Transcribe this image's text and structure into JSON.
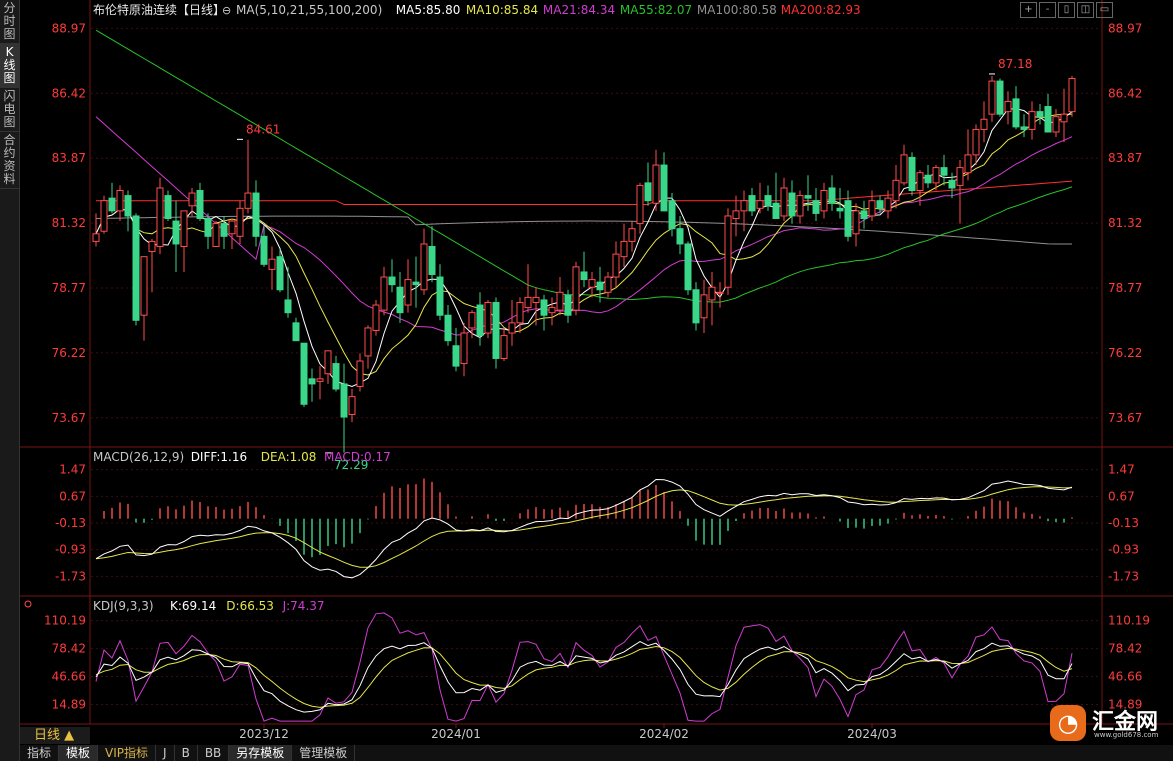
{
  "sidebar": {
    "tabs": [
      "分时图",
      "K线图",
      "闪电图",
      "合约资料"
    ],
    "active_index": 1
  },
  "toolbar": {
    "buttons": [
      "+",
      "-",
      "▯",
      "◫",
      "▭"
    ]
  },
  "footer": {
    "period_label": "日线 ▲",
    "tabs": [
      "指标",
      "模板",
      "VIP指标",
      "J",
      "B",
      "BB",
      "另存模板",
      "管理模板"
    ],
    "active_tabs": [
      1,
      6
    ]
  },
  "logo": {
    "text": "汇金网",
    "url": "www.gold678.com"
  },
  "colors": {
    "up": "#ff4d4d",
    "down": "#3ad68a",
    "ma5": "#ffffff",
    "ma10": "#e6e64a",
    "ma21": "#d23cd2",
    "ma55": "#28c228",
    "ma100": "#909090",
    "ma200": "#ff3030",
    "label_red": "#ff3b3b",
    "label_green": "#3ad68a",
    "grid": "#3a0e0e"
  },
  "chart_data": [
    {
      "type": "candlestick",
      "title": "布伦特原油连续【日线】",
      "legend": [
        {
          "text": "MA(5,10,21,55,100,200)",
          "color": "#c8c8c8"
        },
        {
          "text": "MA5:85.80",
          "color": "#ffffff"
        },
        {
          "text": "MA10:85.84",
          "color": "#e6e64a"
        },
        {
          "text": "MA21:84.34",
          "color": "#d23cd2"
        },
        {
          "text": "MA55:82.07",
          "color": "#28c228"
        },
        {
          "text": "MA100:80.58",
          "color": "#909090"
        },
        {
          "text": "MA200:82.93",
          "color": "#ff3030"
        }
      ],
      "ylim": [
        72.6,
        89.3
      ],
      "yticks": [
        88.97,
        86.42,
        83.87,
        81.32,
        78.77,
        76.22,
        73.67
      ],
      "xtick_labels": [
        "2023/12",
        "2024/01",
        "2024/02",
        "2024/03"
      ],
      "xtick_index": [
        21,
        45,
        71,
        97
      ],
      "annotations": [
        {
          "text": "84.61",
          "index": 18,
          "value": 84.61,
          "color": "#ff3b3b"
        },
        {
          "text": "72.29",
          "index": 29,
          "value": 72.29,
          "color": "#3ad68a"
        },
        {
          "text": "87.18",
          "index": 112,
          "value": 87.18,
          "color": "#ff3b3b"
        }
      ],
      "candles": [
        [
          80.6,
          81.7,
          80.4,
          80.9
        ],
        [
          81.0,
          82.4,
          80.9,
          82.2
        ],
        [
          82.3,
          82.9,
          81.7,
          81.8
        ],
        [
          81.8,
          82.8,
          81.4,
          82.6
        ],
        [
          82.4,
          82.6,
          81.0,
          81.6
        ],
        [
          81.6,
          81.7,
          77.3,
          77.5
        ],
        [
          77.7,
          80.0,
          76.7,
          80.0
        ],
        [
          80.2,
          80.7,
          78.6,
          80.6
        ],
        [
          80.4,
          83.1,
          80.1,
          82.7
        ],
        [
          82.4,
          82.6,
          81.4,
          81.5
        ],
        [
          81.4,
          82.2,
          79.4,
          80.5
        ],
        [
          80.4,
          81.8,
          79.4,
          81.8
        ],
        [
          82.0,
          82.7,
          81.6,
          82.5
        ],
        [
          82.6,
          82.9,
          81.4,
          81.5
        ],
        [
          81.5,
          81.7,
          80.3,
          80.8
        ],
        [
          80.4,
          81.4,
          80.4,
          81.3
        ],
        [
          81.3,
          81.6,
          80.3,
          80.8
        ],
        [
          80.9,
          81.5,
          80.3,
          81.4
        ],
        [
          80.8,
          82.2,
          80.5,
          81.9
        ],
        [
          81.9,
          84.6,
          81.7,
          82.5
        ],
        [
          82.5,
          83.0,
          80.4,
          80.8
        ],
        [
          80.8,
          81.2,
          79.6,
          79.7
        ],
        [
          79.5,
          80.4,
          78.7,
          79.9
        ],
        [
          80.0,
          80.3,
          78.6,
          78.7
        ],
        [
          78.3,
          79.6,
          77.6,
          77.8
        ],
        [
          77.4,
          77.6,
          76.7,
          76.7
        ],
        [
          76.6,
          76.6,
          74.1,
          74.2
        ],
        [
          75.2,
          75.6,
          74.3,
          75.0
        ],
        [
          75.1,
          75.7,
          74.4,
          75.2
        ],
        [
          75.4,
          76.3,
          75.0,
          76.3
        ],
        [
          75.8,
          76.1,
          74.7,
          74.8
        ],
        [
          75.0,
          75.8,
          72.3,
          73.7
        ],
        [
          73.8,
          74.8,
          73.5,
          74.5
        ],
        [
          74.9,
          76.2,
          74.7,
          75.9
        ],
        [
          76.1,
          77.3,
          75.6,
          77.2
        ],
        [
          77.1,
          78.3,
          76.9,
          78.1
        ],
        [
          77.9,
          79.6,
          77.7,
          79.2
        ],
        [
          79.2,
          79.9,
          78.6,
          78.9
        ],
        [
          78.8,
          79.4,
          77.4,
          77.8
        ],
        [
          78.1,
          79.9,
          77.8,
          79.1
        ],
        [
          79.0,
          80.0,
          78.0,
          78.9
        ],
        [
          78.7,
          81.1,
          78.5,
          80.5
        ],
        [
          80.4,
          81.2,
          79.0,
          79.3
        ],
        [
          79.2,
          79.7,
          77.5,
          77.7
        ],
        [
          77.7,
          78.1,
          76.5,
          76.7
        ],
        [
          76.5,
          77.2,
          75.5,
          75.7
        ],
        [
          75.8,
          77.4,
          75.3,
          77.0
        ],
        [
          77.2,
          77.9,
          76.8,
          77.8
        ],
        [
          78.1,
          78.6,
          76.5,
          76.9
        ],
        [
          77.0,
          78.3,
          76.8,
          78.2
        ],
        [
          78.2,
          78.4,
          75.6,
          76.0
        ],
        [
          76.0,
          77.2,
          75.9,
          76.9
        ],
        [
          77.0,
          78.3,
          76.5,
          77.4
        ],
        [
          77.4,
          78.4,
          77.0,
          78.2
        ],
        [
          78.0,
          79.7,
          77.8,
          78.4
        ],
        [
          78.2,
          78.8,
          77.3,
          78.4
        ],
        [
          78.3,
          78.5,
          77.1,
          77.7
        ],
        [
          77.8,
          78.4,
          77.3,
          78.0
        ],
        [
          77.9,
          79.2,
          77.7,
          78.6
        ],
        [
          78.5,
          78.7,
          77.4,
          77.7
        ],
        [
          77.9,
          79.8,
          77.7,
          79.6
        ],
        [
          79.4,
          80.2,
          78.8,
          79.1
        ],
        [
          78.8,
          79.4,
          78.4,
          79.1
        ],
        [
          79.0,
          79.6,
          78.2,
          78.7
        ],
        [
          78.6,
          79.4,
          78.4,
          79.2
        ],
        [
          79.2,
          80.6,
          78.8,
          80.1
        ],
        [
          80.0,
          81.3,
          79.6,
          80.6
        ],
        [
          80.6,
          81.4,
          80.2,
          81.1
        ],
        [
          81.3,
          82.9,
          80.9,
          82.8
        ],
        [
          82.9,
          83.7,
          82.0,
          82.2
        ],
        [
          82.1,
          84.2,
          81.8,
          83.6
        ],
        [
          83.6,
          84.1,
          81.8,
          81.8
        ],
        [
          82.2,
          82.5,
          80.8,
          81.1
        ],
        [
          81.1,
          81.6,
          80.1,
          80.5
        ],
        [
          80.5,
          80.6,
          78.5,
          78.7
        ],
        [
          78.7,
          79.0,
          77.1,
          77.4
        ],
        [
          77.6,
          79.1,
          77.0,
          78.5
        ],
        [
          78.3,
          79.4,
          77.3,
          78.8
        ],
        [
          78.6,
          79.0,
          78.0,
          78.6
        ],
        [
          78.8,
          81.9,
          78.5,
          81.6
        ],
        [
          81.5,
          82.4,
          80.8,
          81.8
        ],
        [
          81.8,
          82.6,
          81.0,
          82.2
        ],
        [
          82.4,
          82.7,
          81.6,
          81.8
        ],
        [
          81.9,
          82.9,
          81.7,
          82.2
        ],
        [
          82.4,
          82.8,
          81.8,
          82.0
        ],
        [
          82.1,
          83.3,
          81.7,
          81.5
        ],
        [
          81.6,
          83.1,
          81.4,
          82.7
        ],
        [
          82.5,
          83.0,
          81.3,
          81.6
        ],
        [
          81.6,
          82.6,
          81.3,
          82.4
        ],
        [
          82.4,
          83.2,
          81.8,
          82.3
        ],
        [
          82.2,
          82.7,
          81.4,
          81.7
        ],
        [
          81.8,
          82.9,
          81.5,
          82.6
        ],
        [
          82.7,
          83.2,
          81.8,
          82.1
        ],
        [
          81.9,
          82.7,
          81.5,
          81.8
        ],
        [
          82.2,
          82.6,
          80.6,
          80.8
        ],
        [
          80.9,
          82.1,
          80.4,
          81.8
        ],
        [
          81.8,
          82.2,
          81.1,
          81.5
        ],
        [
          81.6,
          82.6,
          81.4,
          82.2
        ],
        [
          82.2,
          82.4,
          81.7,
          81.9
        ],
        [
          81.8,
          82.6,
          81.5,
          82.3
        ],
        [
          82.2,
          83.6,
          81.9,
          83.0
        ],
        [
          82.9,
          84.4,
          82.8,
          84.0
        ],
        [
          83.9,
          84.1,
          82.4,
          82.6
        ],
        [
          82.6,
          83.4,
          82.0,
          83.3
        ],
        [
          83.2,
          83.6,
          82.7,
          82.9
        ],
        [
          82.9,
          83.6,
          82.6,
          83.5
        ],
        [
          83.5,
          84.0,
          82.8,
          83.2
        ],
        [
          83.0,
          83.3,
          82.3,
          82.7
        ],
        [
          82.8,
          83.8,
          81.3,
          83.5
        ],
        [
          83.3,
          85.0,
          83.0,
          84.0
        ],
        [
          84.0,
          85.2,
          83.6,
          85.0
        ],
        [
          85.0,
          86.1,
          84.5,
          85.4
        ],
        [
          85.6,
          87.1,
          85.3,
          86.9
        ],
        [
          86.9,
          87.0,
          85.5,
          85.6
        ],
        [
          85.7,
          86.5,
          85.2,
          86.1
        ],
        [
          86.2,
          86.7,
          85.0,
          85.1
        ],
        [
          85.1,
          85.6,
          84.7,
          85.0
        ],
        [
          85.0,
          86.1,
          84.6,
          85.7
        ],
        [
          85.7,
          86.0,
          85.2,
          85.5
        ],
        [
          85.9,
          86.4,
          84.9,
          84.9
        ],
        [
          84.9,
          85.8,
          84.7,
          85.5
        ],
        [
          85.3,
          86.6,
          84.5,
          85.6
        ],
        [
          85.7,
          87.1,
          85.5,
          87.0
        ]
      ]
    },
    {
      "type": "macd",
      "title": "MACD(26,12,9)",
      "legend": [
        {
          "text": "MACD(26,12,9)",
          "color": "#c8c8c8"
        },
        {
          "text": "DIFF:1.16",
          "color": "#ffffff"
        },
        {
          "text": "DEA:1.08",
          "color": "#e6e64a"
        },
        {
          "text": "MACD:0.17",
          "color": "#d23cd2"
        }
      ],
      "ylim": [
        -2.2,
        1.7
      ],
      "yticks": [
        1.47,
        0.67,
        -0.13,
        -0.93,
        -1.73
      ]
    },
    {
      "type": "kdj",
      "title": "KDJ(9,3,3)",
      "legend": [
        {
          "text": "KDJ(9,3,3)",
          "color": "#c8c8c8"
        },
        {
          "text": "K:69.14",
          "color": "#ffffff"
        },
        {
          "text": "D:66.53",
          "color": "#e6e64a"
        },
        {
          "text": "J:74.37",
          "color": "#d23cd2"
        }
      ],
      "ylim": [
        -5,
        120
      ],
      "yticks": [
        110.19,
        78.42,
        46.66,
        14.89
      ]
    }
  ]
}
